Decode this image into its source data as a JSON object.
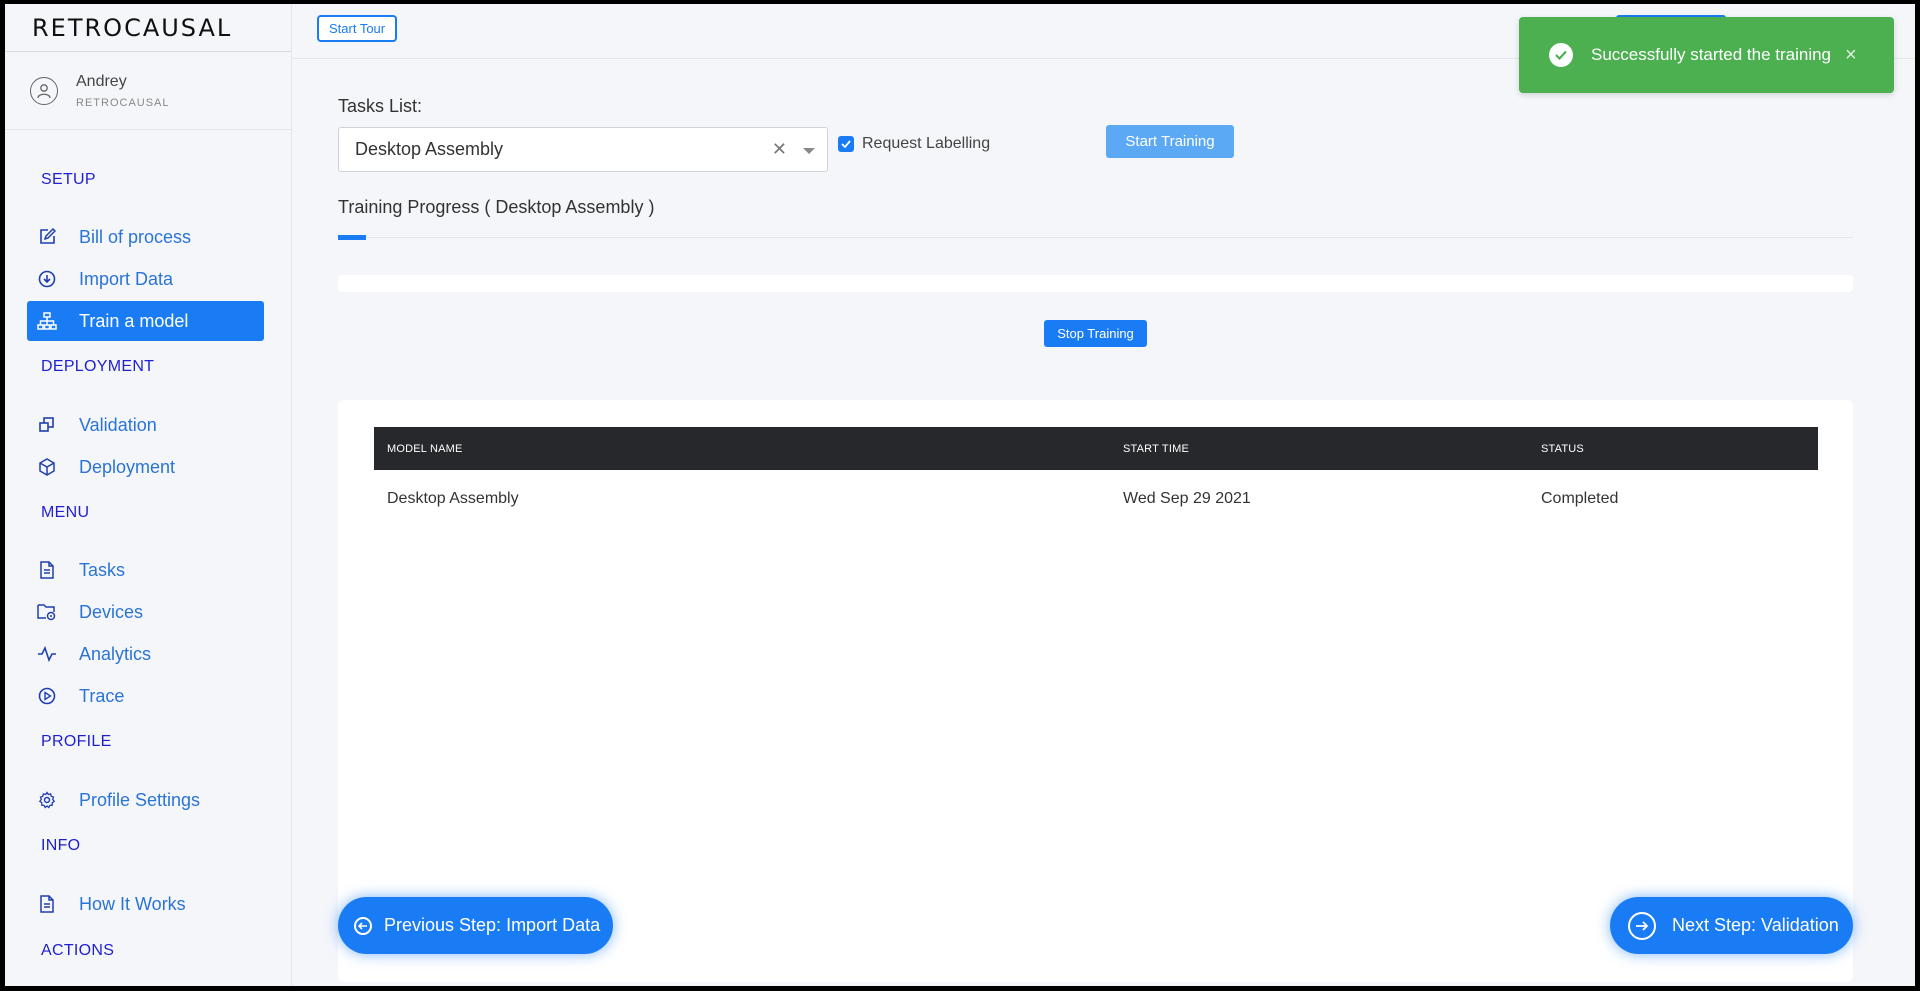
{
  "brand": {
    "logo_text": "RETROCAUSAL"
  },
  "user": {
    "name": "Andrey",
    "org": "RETROCAUSAL"
  },
  "sidebar": {
    "sections": [
      "SETUP",
      "DEPLOYMENT",
      "MENU",
      "PROFILE",
      "INFO",
      "ACTIONS"
    ],
    "items": [
      {
        "label": "Bill of process",
        "icon": "edit-icon"
      },
      {
        "label": "Import Data",
        "icon": "download-circle-icon"
      },
      {
        "label": "Train a model",
        "icon": "sitemap-icon",
        "active": true
      },
      {
        "label": "Validation",
        "icon": "copy-icon"
      },
      {
        "label": "Deployment",
        "icon": "box-icon"
      },
      {
        "label": "Tasks",
        "icon": "document-icon"
      },
      {
        "label": "Devices",
        "icon": "folder-settings-icon"
      },
      {
        "label": "Analytics",
        "icon": "activity-icon"
      },
      {
        "label": "Trace",
        "icon": "play-circle-icon"
      },
      {
        "label": "Profile Settings",
        "icon": "gear-icon"
      },
      {
        "label": "How It Works",
        "icon": "document-icon"
      }
    ]
  },
  "topbar": {
    "tour_label": "Start Tour"
  },
  "toast": {
    "message": "Successfully started the training",
    "close": "×",
    "color": "#4caf50"
  },
  "main": {
    "tasks_label": "Tasks List:",
    "selected_task": "Desktop Assembly",
    "clear_symbol": "✕",
    "request_labelling_label": "Request Labelling",
    "request_labelling_checked": true,
    "start_training_label": "Start Training",
    "progress_title": "Training Progress ( Desktop Assembly )",
    "stop_training_label": "Stop Training"
  },
  "table": {
    "headers": [
      "MODEL NAME",
      "START TIME",
      "STATUS"
    ],
    "rows": [
      [
        "Desktop Assembly",
        "Wed Sep 29 2021",
        "Completed"
      ]
    ]
  },
  "footer": {
    "prev_label": "Previous Step: Import Data",
    "next_label": "Next Step: Validation"
  },
  "colors": {
    "accent": "#1a7cf5",
    "section": "#1f1fd0",
    "nav_text": "#2a74d6"
  }
}
